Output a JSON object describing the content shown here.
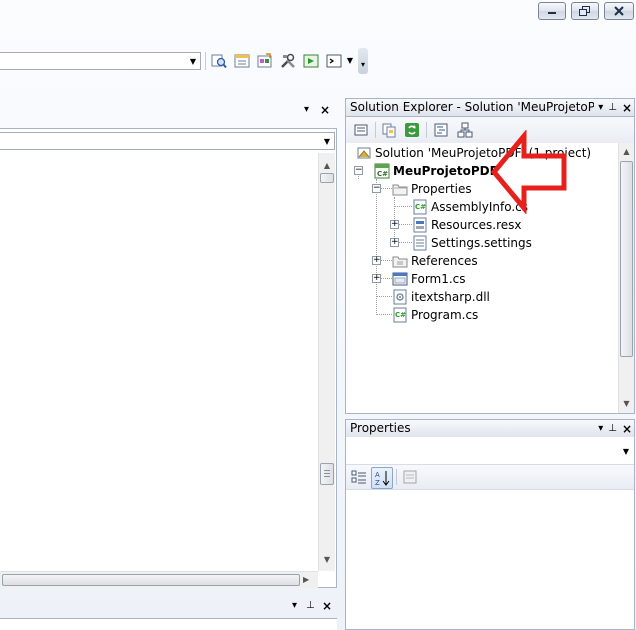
{
  "window": {
    "minimize_icon": "minimize-icon",
    "restore_icon": "restore-icon",
    "close_icon": "close-icon"
  },
  "toolbar": {
    "icons": [
      "find-in-files-icon",
      "properties-window-icon",
      "object-browser-icon",
      "tools-icon",
      "start-page-icon",
      "command-window-icon"
    ]
  },
  "solution_explorer": {
    "title": "Solution Explorer - Solution 'MeuProjetoP...",
    "toolbar_icons": [
      "properties-icon",
      "show-all-files-icon",
      "refresh-icon",
      "view-code-icon",
      "class-diagram-icon"
    ],
    "solution": "Solution 'MeuProjetoPDF' (1 project)",
    "project": "MeuProjetoPDF",
    "items": {
      "properties": "Properties",
      "assembly_info": "AssemblyInfo.cs",
      "resources": "Resources.resx",
      "settings": "Settings.settings",
      "references": "References",
      "form1": "Form1.cs",
      "itextsharp": "itextsharp.dll",
      "program": "Program.cs"
    }
  },
  "properties_panel": {
    "title": "Properties",
    "buttons": [
      "categorized-icon",
      "alphabetical-icon",
      "property-pages-icon"
    ]
  },
  "colors": {
    "arrow": "#e8201c",
    "selection": "#3399ff",
    "panel_border": "#a9b4c4"
  }
}
